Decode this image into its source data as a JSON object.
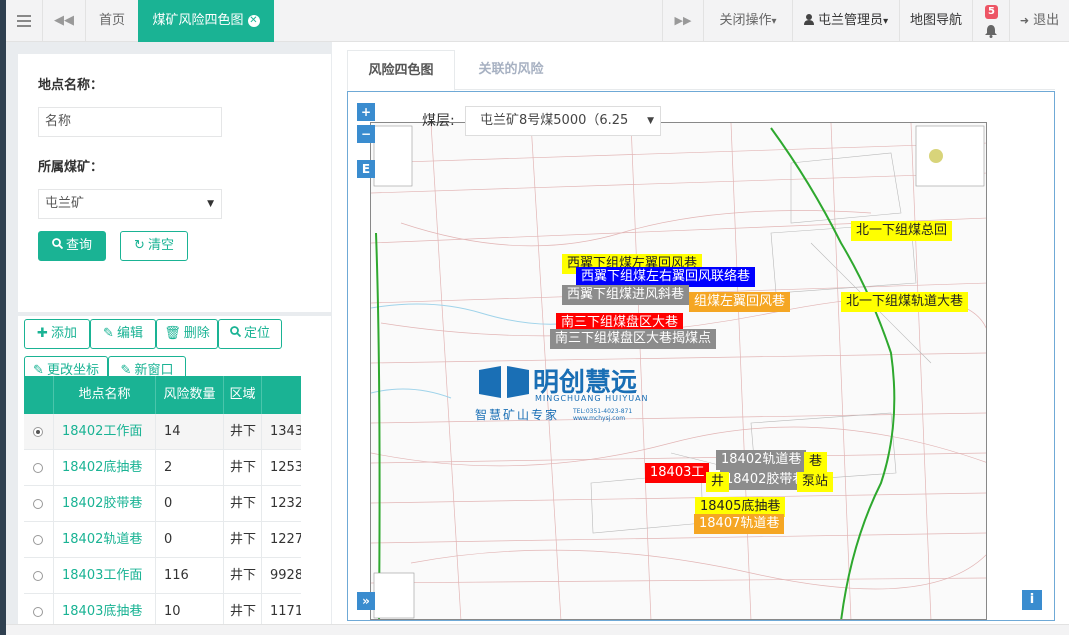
{
  "topbar": {
    "menu_icon": "hamburger-icon",
    "back_icon": "double-left-icon",
    "home_tab": "首页",
    "active_tab": "煤矿风险四色图",
    "forward_icon": "double-right-icon",
    "close_ops": "关闭操作",
    "user_icon": "user-icon",
    "user": "屯兰管理员",
    "map_nav": "地图导航",
    "bell_icon": "bell-icon",
    "badge_count": "5",
    "logout_icon": "logout-icon",
    "logout": "退出",
    "caret": "▾"
  },
  "search": {
    "location_label": "地点名称：",
    "location_placeholder": "名称",
    "mine_label": "所属煤矿：",
    "mine_value": "屯兰矿",
    "query_label": "查询",
    "clear_label": "清空"
  },
  "toolbar": {
    "add": "添加",
    "edit": "编辑",
    "delete": "删除",
    "locate": "定位",
    "change_coords": "更改坐标",
    "new_window": "新窗口"
  },
  "table": {
    "headers": [
      "地点名称",
      "风险数量",
      "区域",
      ""
    ],
    "rows": [
      {
        "name": "18402工作面",
        "count": "14",
        "area": "井下",
        "extra": "1343",
        "selected": true
      },
      {
        "name": "18402底抽巷",
        "count": "2",
        "area": "井下",
        "extra": "1253",
        "selected": false
      },
      {
        "name": "18402胶带巷",
        "count": "0",
        "area": "井下",
        "extra": "1232",
        "selected": false
      },
      {
        "name": "18402轨道巷",
        "count": "0",
        "area": "井下",
        "extra": "1227",
        "selected": false
      },
      {
        "name": "18403工作面",
        "count": "116",
        "area": "井下",
        "extra": "9928",
        "selected": false
      },
      {
        "name": "18403底抽巷",
        "count": "10",
        "area": "井下",
        "extra": "1171",
        "selected": false
      }
    ]
  },
  "tabs": {
    "map_tab": "风险四色图",
    "related_tab": "关联的风险"
  },
  "map": {
    "coal_label": "煤层:",
    "coal_value": "屯兰矿8号煤5000（6.25",
    "zoom_in": "+",
    "zoom_out": "−",
    "e_btn": "E",
    "expand": "»",
    "info": "i",
    "logo_cn": "明创慧远",
    "logo_en": "MINGCHUANG HUIYUAN",
    "logo_slogan": "智慧矿山专家",
    "logo_small": "TEL:0351-4023-871 www.mchysj.com",
    "labels": [
      {
        "text": "西翼下组煤左翼回风巷",
        "color": "yellow"
      },
      {
        "text": "西翼下组煤左右翼回风联络巷",
        "color": "blue"
      },
      {
        "text": "西翼下组煤进风斜巷",
        "color": "gray"
      },
      {
        "text": "组煤左翼回风巷",
        "color": "orange"
      },
      {
        "text": "南三下组煤盘区大巷",
        "color": "red"
      },
      {
        "text": "南三下组煤盘区大巷揭煤点",
        "color": "gray"
      },
      {
        "text": "北一下组煤总回",
        "color": "yellow"
      },
      {
        "text": "北一下组煤轨道大巷",
        "color": "yellow"
      },
      {
        "text": "18402轨道巷",
        "color": "gray"
      },
      {
        "text": "18402胶带巷",
        "color": "gray"
      },
      {
        "text": "18403工",
        "color": "red"
      },
      {
        "text": "18405底抽巷",
        "color": "yellow"
      },
      {
        "text": "18407轨道巷",
        "color": "orange"
      },
      {
        "text": "泵站",
        "color": "yellow"
      },
      {
        "text": "巷",
        "color": "yellow"
      },
      {
        "text": "井",
        "color": "yellow"
      }
    ]
  }
}
